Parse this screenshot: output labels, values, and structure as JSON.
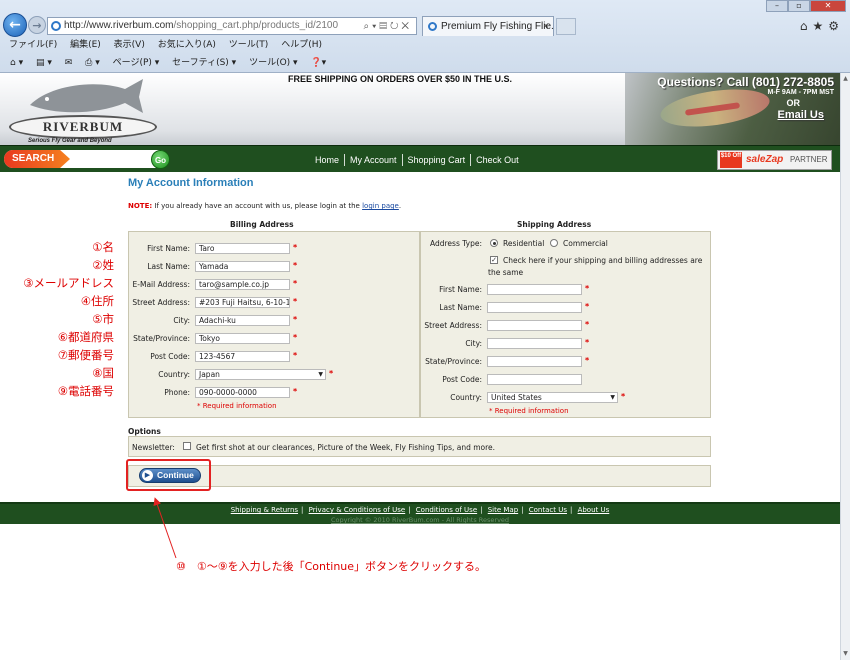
{
  "browser": {
    "url_base": "http://www.riverbum.com",
    "url_path": "/shopping_cart.php/products_id/2100",
    "tab_title": "Premium Fly Fishing Flie...",
    "menus": [
      "ファイル(F)",
      "編集(E)",
      "表示(V)",
      "お気に入り(A)",
      "ツール(T)",
      "ヘルプ(H)"
    ],
    "commands": [
      "ページ(P) ▾",
      "セーフティ(S) ▾",
      "ツール(O) ▾"
    ]
  },
  "header": {
    "shipping_banner": "FREE SHIPPING ON ORDERS OVER $50 IN THE U.S.",
    "logo_text": "RIVERBUM",
    "logo_tagline": "Serious Fly Gear and Beyond",
    "phone": "Questions? Call (801) 272-8805",
    "hours": "M-F 9AM - 7PM MST",
    "or": "OR",
    "email": "Email Us"
  },
  "nav": {
    "search_label": "SEARCH",
    "go_label": "Go",
    "links": [
      "Home",
      "My Account",
      "Shopping Cart",
      "Check Out"
    ],
    "partner_deal": "$10 Off",
    "partner_brand": "saleZap",
    "partner_label": "PARTNER"
  },
  "form": {
    "title": "My Account Information",
    "note_prefix": "NOTE:",
    "note_text": " If you already have an account with us, please login at the ",
    "note_link": "login page",
    "note_suffix": ".",
    "billing": {
      "heading": "Billing Address",
      "fields": [
        {
          "label": "First Name:",
          "value": "Taro"
        },
        {
          "label": "Last Name:",
          "value": "Yamada"
        },
        {
          "label": "E-Mail Address:",
          "value": "taro@sample.co.jp"
        },
        {
          "label": "Street Address:",
          "value": "#203 Fuji Haitsu, 6-10-1"
        },
        {
          "label": "City:",
          "value": "Adachi-ku"
        },
        {
          "label": "State/Province:",
          "value": "Tokyo"
        },
        {
          "label": "Post Code:",
          "value": "123-4567"
        },
        {
          "label": "Country:",
          "value": "Japan"
        },
        {
          "label": "Phone:",
          "value": "090-0000-0000"
        }
      ],
      "required": "* Required information"
    },
    "shipping": {
      "heading": "Shipping Address",
      "address_type_label": "Address Type:",
      "residential": "Residential",
      "commercial": "Commercial",
      "same_text_1": "Check here if your shipping and billing addresses are",
      "same_text_2": "the same",
      "fields": [
        {
          "label": "First Name:",
          "value": ""
        },
        {
          "label": "Last Name:",
          "value": ""
        },
        {
          "label": "Street Address:",
          "value": ""
        },
        {
          "label": "City:",
          "value": ""
        },
        {
          "label": "State/Province:",
          "value": ""
        },
        {
          "label": "Post Code:",
          "value": ""
        },
        {
          "label": "Country:",
          "value": "United States"
        }
      ],
      "required": "* Required information"
    },
    "options_heading": "Options",
    "newsletter_label": "Newsletter:",
    "newsletter_text": "Get first shot at our clearances, Picture of the Week, Fly Fishing Tips, and more.",
    "continue_label": "Continue"
  },
  "annotations": [
    "①名",
    "②姓",
    "③メールアドレス",
    "④住所",
    "⑤市",
    "⑥都道府県",
    "⑦郵便番号",
    "⑧国",
    "⑨電話番号"
  ],
  "instruction": "⑩　①〜⑨を入力した後「Continue」ボタンをクリックする。",
  "footer": {
    "links": [
      "Shipping & Returns",
      "Privacy & Conditions of Use",
      "Conditions of Use",
      "Site Map",
      "Contact Us",
      "About Us"
    ],
    "copyright": "Copyright © 2010 RiverBum.com - All Rights Reserved"
  },
  "colors": {
    "accent": "#2a7fb8",
    "nav_green": "#1f4f1f",
    "annotation_red": "#dd0000"
  }
}
